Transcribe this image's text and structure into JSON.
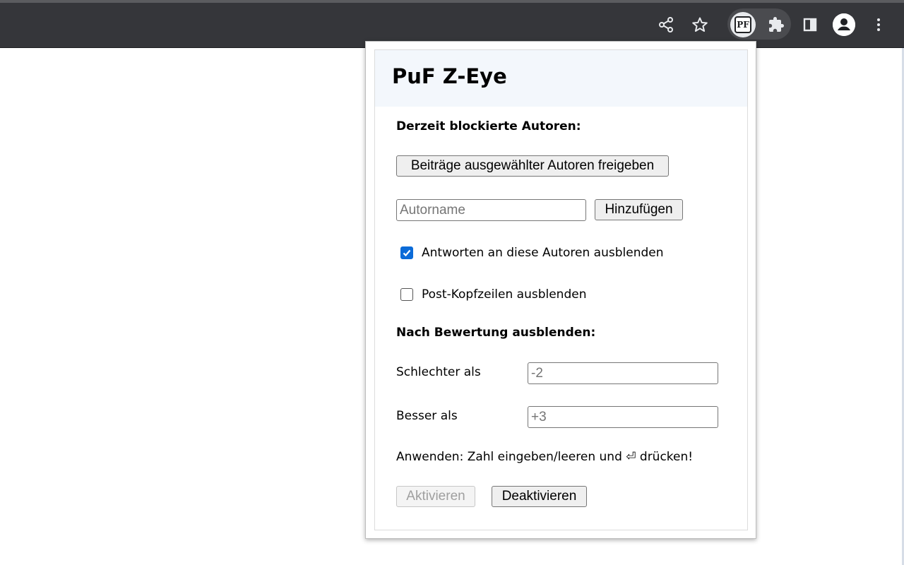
{
  "toolbar": {
    "icons": [
      "share-icon",
      "star-icon",
      "puf-extension-icon",
      "puzzle-icon",
      "sidepanel-icon",
      "profile-icon",
      "more-icon"
    ],
    "extension_badge": "PF"
  },
  "popup": {
    "title": "PuF Z-Eye",
    "blocked_heading": "Derzeit blockierte Autoren:",
    "release_button": "Beiträge ausgewählter Autoren freigeben",
    "author_input": {
      "placeholder": "Autorname",
      "value": ""
    },
    "add_button": "Hinzufügen",
    "hide_replies": {
      "label": "Antworten an diese Autoren ausblenden",
      "checked": true
    },
    "hide_headers": {
      "label": "Post-Kopfzeilen ausblenden",
      "checked": false
    },
    "rating_heading": "Nach Bewertung ausblenden:",
    "worse_than": {
      "label": "Schlechter als",
      "placeholder": "-2"
    },
    "better_than": {
      "label": "Besser als",
      "placeholder": "+3"
    },
    "hint": "Anwenden: Zahl eingeben/leeren und ⏎ drücken!",
    "activate_button": "Aktivieren",
    "deactivate_button": "Deaktivieren"
  },
  "colors": {
    "toolbar_bg": "#35363a",
    "header_bg": "#f3f7fc",
    "checkbox_accent": "#0b6bd8"
  }
}
